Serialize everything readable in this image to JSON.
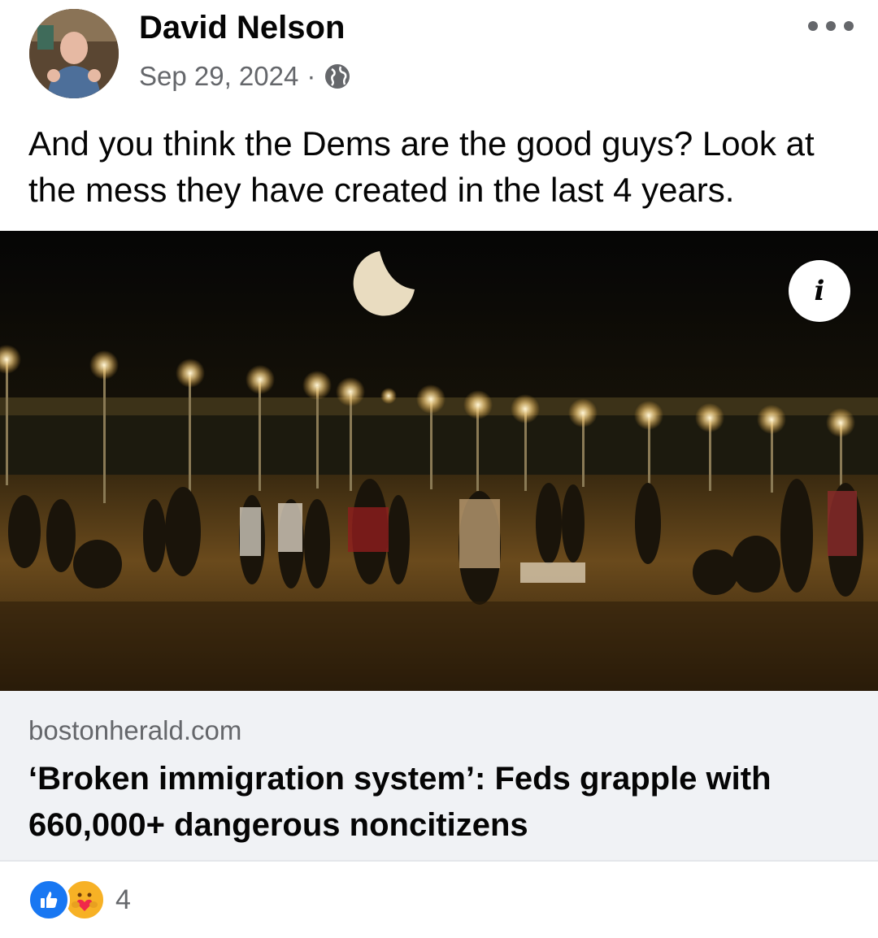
{
  "post": {
    "author": "David Nelson",
    "date": "Sep 29, 2024",
    "separator": "·",
    "privacy_icon": "globe-icon",
    "more_icon": "more-options-icon",
    "text": "And you think the Dems are the good guys? Look at the mess they have created in the last 4 years."
  },
  "link": {
    "info_icon": "info-icon",
    "info_label": "i",
    "domain": "bostonherald.com",
    "headline": "‘Broken immigration system’: Feds grapple with 660,000+ dangerous noncitizens"
  },
  "reactions": {
    "icons": [
      "like-reaction-icon",
      "care-reaction-icon"
    ],
    "count": "4"
  },
  "colors": {
    "like": "#1877f2",
    "care": "#f7b125",
    "secondary_text": "#65676b",
    "card_bg": "#f0f2f5"
  }
}
